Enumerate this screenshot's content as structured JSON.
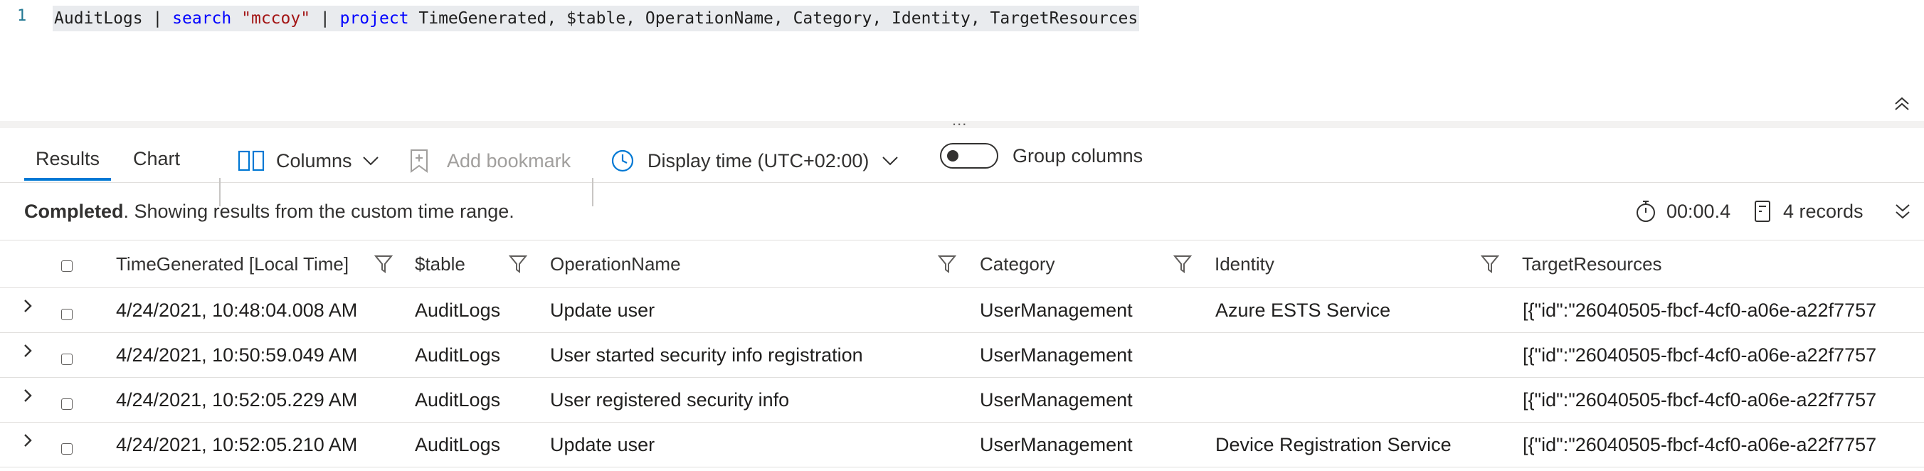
{
  "editor": {
    "line_number": "1",
    "tokens": [
      {
        "text": "AuditLogs | ",
        "kind": "plain"
      },
      {
        "text": "search",
        "kind": "kw"
      },
      {
        "text": " ",
        "kind": "plain"
      },
      {
        "text": "\"mccoy\"",
        "kind": "str"
      },
      {
        "text": " | ",
        "kind": "plain"
      },
      {
        "text": "project",
        "kind": "kw"
      },
      {
        "text": " TimeGenerated, $table, OperationName, Category, Identity, TargetResources",
        "kind": "plain"
      }
    ],
    "splitter_glyph": "..."
  },
  "toolbar": {
    "tab_results": "Results",
    "tab_chart": "Chart",
    "columns_label": "Columns",
    "add_bookmark_label": "Add bookmark",
    "display_time_label": "Display time (UTC+02:00)",
    "group_columns_label": "Group columns",
    "group_columns_on": false
  },
  "status": {
    "completed": "Completed",
    "message": ". Showing results from the custom time range.",
    "duration": "00:00.4",
    "records": "4 records"
  },
  "table": {
    "headers": [
      "TimeGenerated [Local Time]",
      "$table",
      "OperationName",
      "Category",
      "Identity",
      "TargetResources"
    ],
    "rows": [
      [
        "4/24/2021, 10:48:04.008 AM",
        "AuditLogs",
        "Update user",
        "UserManagement",
        "Azure ESTS Service",
        "[{\"id\":\"26040505-fbcf-4cf0-a06e-a22f7757"
      ],
      [
        "4/24/2021, 10:50:59.049 AM",
        "AuditLogs",
        "User started security info registration",
        "UserManagement",
        "",
        "[{\"id\":\"26040505-fbcf-4cf0-a06e-a22f7757"
      ],
      [
        "4/24/2021, 10:52:05.229 AM",
        "AuditLogs",
        "User registered security info",
        "UserManagement",
        "",
        "[{\"id\":\"26040505-fbcf-4cf0-a06e-a22f7757"
      ],
      [
        "4/24/2021, 10:52:05.210 AM",
        "AuditLogs",
        "Update user",
        "UserManagement",
        "Device Registration Service",
        "[{\"id\":\"26040505-fbcf-4cf0-a06e-a22f7757"
      ]
    ]
  },
  "colors": {
    "accent": "#0078d4",
    "keyword": "#0000ff",
    "string": "#a31515",
    "line_number": "#237893"
  }
}
